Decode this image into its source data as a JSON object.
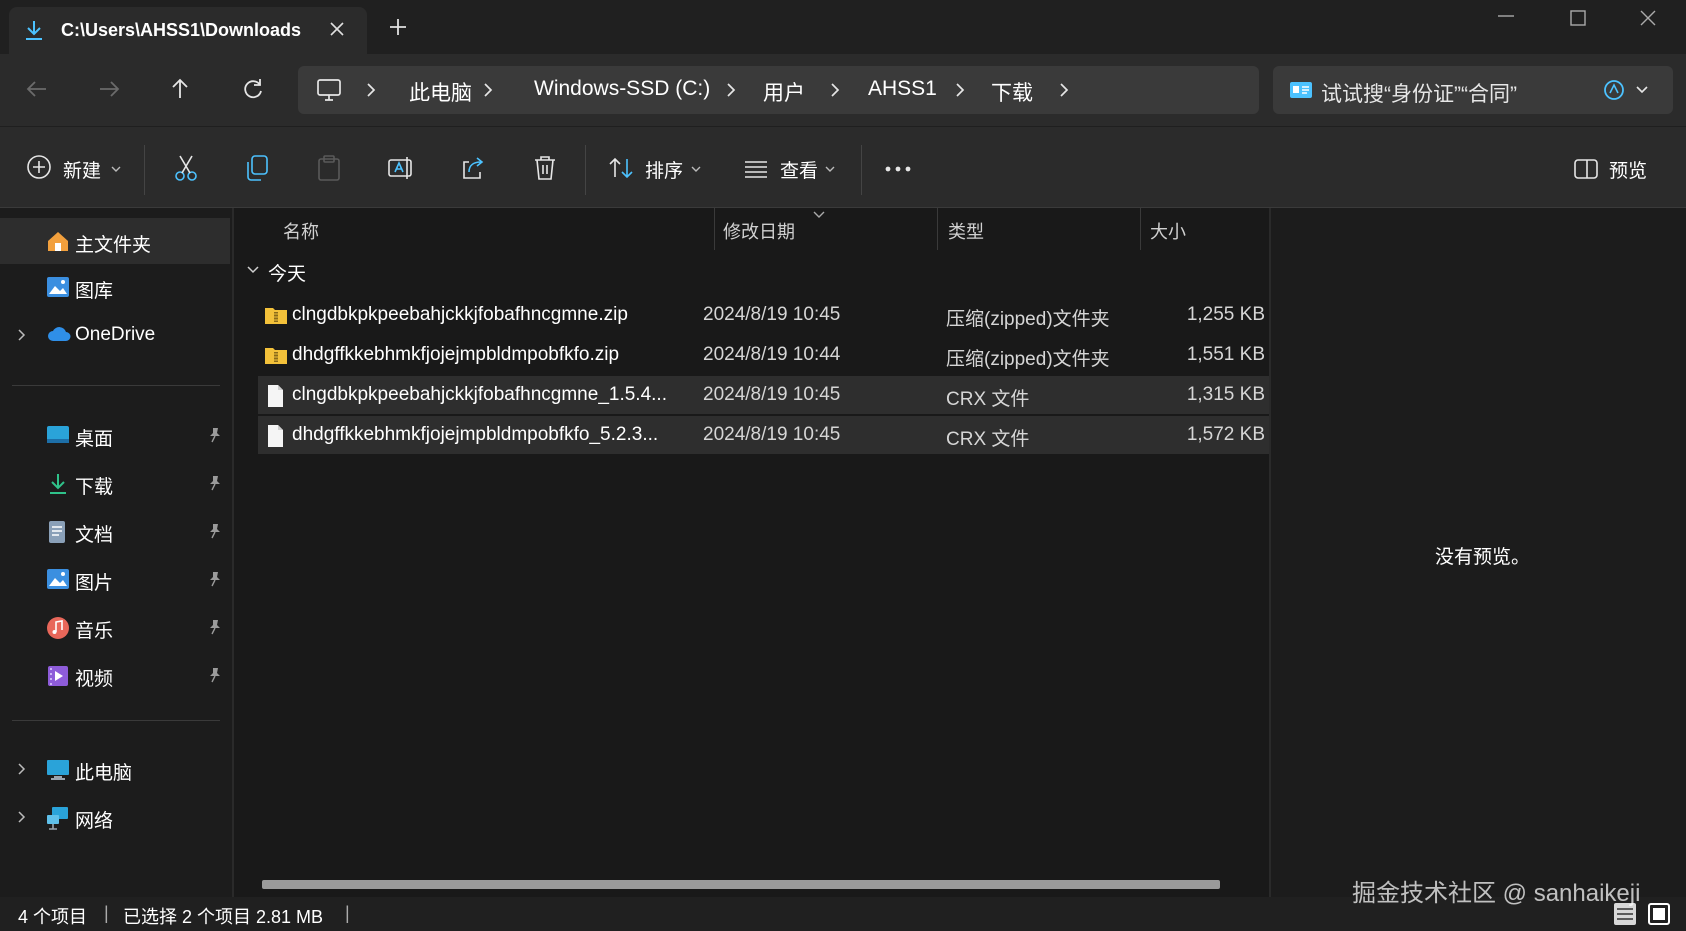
{
  "tab": {
    "title": "C:\\Users\\AHSS1\\Downloads"
  },
  "breadcrumb": [
    "此电脑",
    "Windows-SSD (C:)",
    "用户",
    "AHSS1",
    "下载"
  ],
  "search": {
    "placeholder": "试试搜“身份证”“合同”"
  },
  "toolbar": {
    "new_label": "新建",
    "sort_label": "排序",
    "view_label": "查看",
    "preview_label": "预览"
  },
  "sidebar": {
    "quick": [
      {
        "label": "主文件夹",
        "icon": "home-icon",
        "active": true
      },
      {
        "label": "图库",
        "icon": "gallery-icon"
      },
      {
        "label": "OneDrive",
        "icon": "cloud-icon",
        "expandable": true
      }
    ],
    "pinned": [
      {
        "label": "桌面",
        "icon": "desktop-icon"
      },
      {
        "label": "下载",
        "icon": "download-icon"
      },
      {
        "label": "文档",
        "icon": "document-icon"
      },
      {
        "label": "图片",
        "icon": "picture-icon"
      },
      {
        "label": "音乐",
        "icon": "music-icon"
      },
      {
        "label": "视频",
        "icon": "video-icon"
      }
    ],
    "locations": [
      {
        "label": "此电脑",
        "icon": "computer-icon"
      },
      {
        "label": "网络",
        "icon": "network-icon"
      }
    ]
  },
  "columns": {
    "name": "名称",
    "date": "修改日期",
    "type": "类型",
    "size": "大小"
  },
  "group": {
    "label": "今天"
  },
  "files": [
    {
      "name": "clngdbkpkpeebahjckkjfobafhncgmne.zip",
      "date": "2024/8/19 10:45",
      "type": "压缩(zipped)文件夹",
      "size": "1,255 KB",
      "icon": "zip-folder-icon",
      "selected": false
    },
    {
      "name": "dhdgffkkebhmkfjojejmpbldmpobfkfo.zip",
      "date": "2024/8/19 10:44",
      "type": "压缩(zipped)文件夹",
      "size": "1,551 KB",
      "icon": "zip-folder-icon",
      "selected": false
    },
    {
      "name": "clngdbkpkpeebahjckkjfobafhncgmne_1.5.4...",
      "date": "2024/8/19 10:45",
      "type": "CRX 文件",
      "size": "1,315 KB",
      "icon": "file-icon",
      "selected": true
    },
    {
      "name": "dhdgffkkebhmkfjojejmpbldmpobfkfo_5.2.3...",
      "date": "2024/8/19 10:45",
      "type": "CRX 文件",
      "size": "1,572 KB",
      "icon": "file-icon",
      "selected": true
    }
  ],
  "preview": {
    "text": "没有预览。"
  },
  "status": {
    "count": "4 个项目",
    "selection": "已选择 2 个项目  2.81 MB"
  },
  "watermark": "掘金技术社区 @ sanhaikeji",
  "colors": {
    "accent": "#4cc2ff",
    "folder": "#f3c13a",
    "background": "#191919",
    "selected_row": "#2e2e2e"
  }
}
